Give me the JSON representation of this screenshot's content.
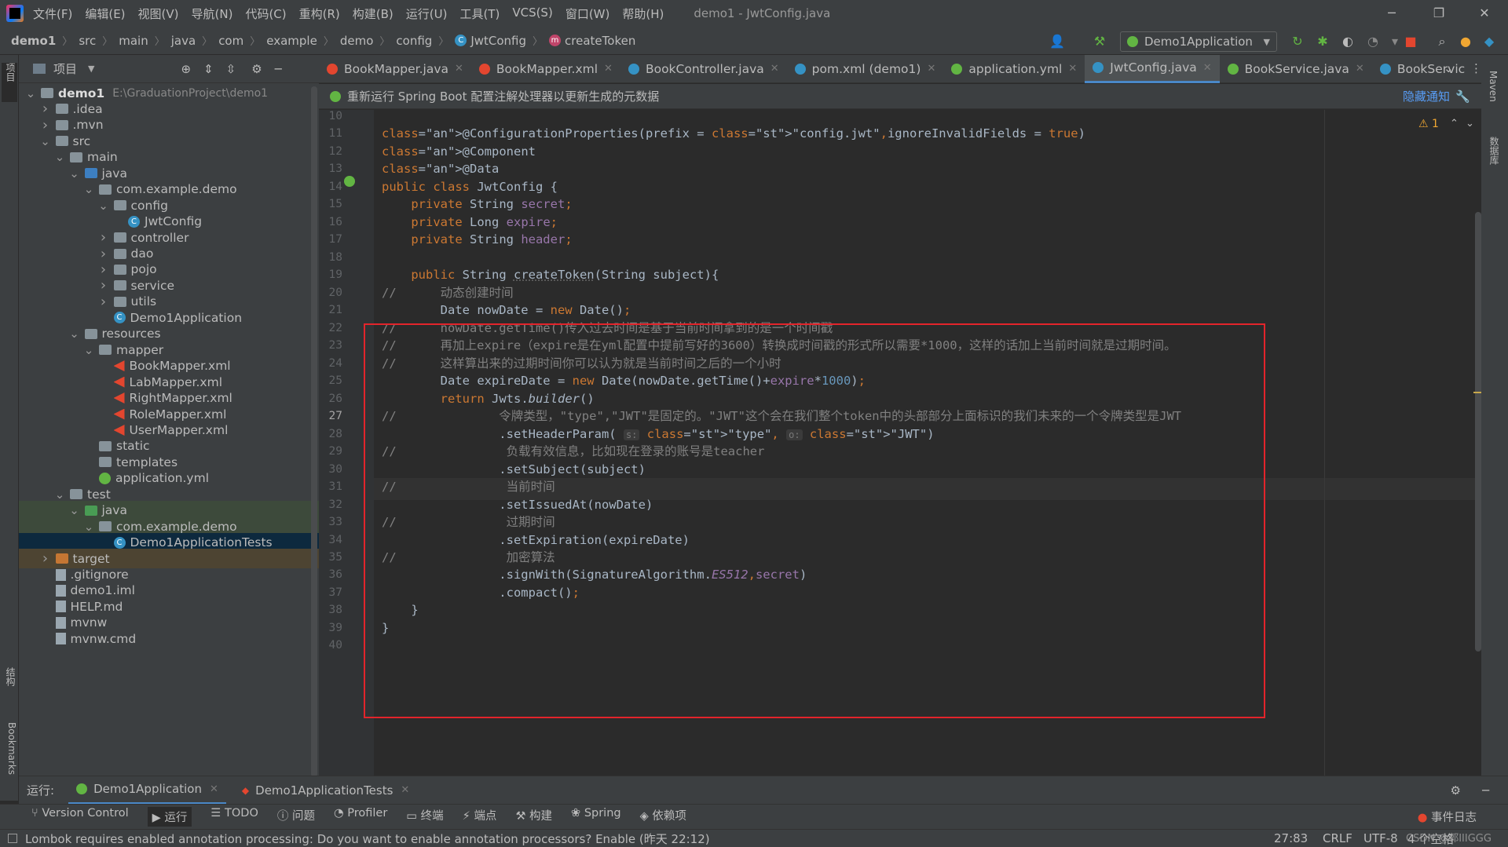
{
  "menu": [
    "文件(F)",
    "编辑(E)",
    "视图(V)",
    "导航(N)",
    "代码(C)",
    "重构(R)",
    "构建(B)",
    "运行(U)",
    "工具(T)",
    "VCS(S)",
    "窗口(W)",
    "帮助(H)"
  ],
  "window_title": "demo1 - JwtConfig.java",
  "breadcrumbs": [
    "demo1",
    "src",
    "main",
    "java",
    "com",
    "example",
    "demo",
    "config",
    "JwtConfig",
    "createToken"
  ],
  "run_config": "Demo1Application",
  "project_panel": {
    "title": "项目"
  },
  "tree": [
    {
      "label": "demo1",
      "extra": "E:\\GraduationProject\\demo1",
      "depth": 0,
      "arrow": "down",
      "icon": "folder"
    },
    {
      "label": ".idea",
      "depth": 1,
      "arrow": "right",
      "icon": "folder"
    },
    {
      "label": ".mvn",
      "depth": 1,
      "arrow": "right",
      "icon": "folder"
    },
    {
      "label": "src",
      "depth": 1,
      "arrow": "down",
      "icon": "folder"
    },
    {
      "label": "main",
      "depth": 2,
      "arrow": "down",
      "icon": "folder"
    },
    {
      "label": "java",
      "depth": 3,
      "arrow": "down",
      "icon": "src"
    },
    {
      "label": "com.example.demo",
      "depth": 4,
      "arrow": "down",
      "icon": "folder"
    },
    {
      "label": "config",
      "depth": 5,
      "arrow": "down",
      "icon": "folder"
    },
    {
      "label": "JwtConfig",
      "depth": 6,
      "arrow": "",
      "icon": "class"
    },
    {
      "label": "controller",
      "depth": 5,
      "arrow": "right",
      "icon": "folder"
    },
    {
      "label": "dao",
      "depth": 5,
      "arrow": "right",
      "icon": "folder"
    },
    {
      "label": "pojo",
      "depth": 5,
      "arrow": "right",
      "icon": "folder"
    },
    {
      "label": "service",
      "depth": 5,
      "arrow": "right",
      "icon": "folder"
    },
    {
      "label": "utils",
      "depth": 5,
      "arrow": "right",
      "icon": "folder"
    },
    {
      "label": "Demo1Application",
      "depth": 5,
      "arrow": "",
      "icon": "class"
    },
    {
      "label": "resources",
      "depth": 3,
      "arrow": "down",
      "icon": "folder"
    },
    {
      "label": "mapper",
      "depth": 4,
      "arrow": "down",
      "icon": "folder"
    },
    {
      "label": "BookMapper.xml",
      "depth": 5,
      "arrow": "",
      "icon": "xml"
    },
    {
      "label": "LabMapper.xml",
      "depth": 5,
      "arrow": "",
      "icon": "xml"
    },
    {
      "label": "RightMapper.xml",
      "depth": 5,
      "arrow": "",
      "icon": "xml"
    },
    {
      "label": "RoleMapper.xml",
      "depth": 5,
      "arrow": "",
      "icon": "xml"
    },
    {
      "label": "UserMapper.xml",
      "depth": 5,
      "arrow": "",
      "icon": "xml"
    },
    {
      "label": "static",
      "depth": 4,
      "arrow": "",
      "icon": "folder"
    },
    {
      "label": "templates",
      "depth": 4,
      "arrow": "",
      "icon": "folder"
    },
    {
      "label": "application.yml",
      "depth": 4,
      "arrow": "",
      "icon": "yml"
    },
    {
      "label": "test",
      "depth": 2,
      "arrow": "down",
      "icon": "folder"
    },
    {
      "label": "java",
      "depth": 3,
      "arrow": "down",
      "icon": "test"
    },
    {
      "label": "com.example.demo",
      "depth": 4,
      "arrow": "down",
      "icon": "folder"
    },
    {
      "label": "Demo1ApplicationTests",
      "depth": 5,
      "arrow": "",
      "icon": "class"
    },
    {
      "label": "target",
      "depth": 1,
      "arrow": "right",
      "icon": "orange"
    },
    {
      "label": ".gitignore",
      "depth": 1,
      "arrow": "",
      "icon": "file"
    },
    {
      "label": "demo1.iml",
      "depth": 1,
      "arrow": "",
      "icon": "file"
    },
    {
      "label": "HELP.md",
      "depth": 1,
      "arrow": "",
      "icon": "file"
    },
    {
      "label": "mvnw",
      "depth": 1,
      "arrow": "",
      "icon": "file"
    },
    {
      "label": "mvnw.cmd",
      "depth": 1,
      "arrow": "",
      "icon": "file"
    }
  ],
  "tabs": [
    {
      "label": "BookMapper.java",
      "color": "#e3462f"
    },
    {
      "label": "BookMapper.xml",
      "color": "#e3462f"
    },
    {
      "label": "BookController.java",
      "color": "#3592c4"
    },
    {
      "label": "pom.xml (demo1)",
      "color": "#3592c4"
    },
    {
      "label": "application.yml",
      "color": "#62b543"
    },
    {
      "label": "JwtConfig.java",
      "color": "#3592c4",
      "active": true
    },
    {
      "label": "BookService.java",
      "color": "#62b543"
    },
    {
      "label": "BookServic",
      "color": "#3592c4"
    }
  ],
  "notice": {
    "text": "重新运行 Spring Boot 配置注解处理器以更新生成的元数据",
    "hide": "隐藏通知"
  },
  "warning_count": "1",
  "code": {
    "first_line": 10,
    "lines": [
      "",
      "@ConfigurationProperties(prefix = \"config.jwt\",ignoreInvalidFields = true)",
      "@Component",
      "@Data",
      "public class JwtConfig {",
      "    private String secret;",
      "    private Long expire;",
      "    private String header;",
      "",
      "    public String createToken(String subject){",
      "//      动态创建时间",
      "        Date nowDate = new Date();",
      "//      nowDate.getTime()传入过去时间是基于当前时间拿到的是一个时间戳",
      "//      再加上expire（expire是在yml配置中提前写好的3600）转换成时间戳的形式所以需要*1000，这样的话加上当前时间就是过期时间。",
      "//      这样算出来的过期时间你可以认为就是当前时间之后的一个小时",
      "        Date expireDate = new Date(nowDate.getTime()+expire*1000);",
      "        return Jwts.builder()",
      "//              令牌类型，\"type\",\"JWT\"是固定的。\"JWT\"这个会在我们整个token中的头部部分上面标识的我们未来的一个令牌类型是JWT",
      "                .setHeaderParam( s: \"type\", o: \"JWT\")",
      "//               负载有效信息，比如现在登录的账号是teacher",
      "                .setSubject(subject)",
      "//               当前时间",
      "                .setIssuedAt(nowDate)",
      "//               过期时间",
      "                .setExpiration(expireDate)",
      "//               加密算法",
      "                .signWith(SignatureAlgorithm.ES512,secret)",
      "                .compact();",
      "    }",
      "}",
      ""
    ]
  },
  "run_bar": {
    "label": "运行:",
    "tabs": [
      "Demo1Application",
      "Demo1ApplicationTests"
    ]
  },
  "bottom_tools": [
    "Version Control",
    "运行",
    "TODO",
    "问题",
    "Profiler",
    "终端",
    "端点",
    "构建",
    "Spring",
    "依赖项"
  ],
  "event_log": "事件日志",
  "status": {
    "message": "Lombok requires enabled annotation processing: Do you want to enable annotation processors? Enable (昨天 22:12)",
    "position": "27:83",
    "line_sep": "CRLF",
    "encoding": "UTF-8",
    "indent": "4 个空格",
    "watermark": "CSDN @郭IIIGGG"
  },
  "left_vertical_tabs": [
    "项目",
    "结构",
    "Bookmarks"
  ],
  "right_vertical_tabs": [
    "Maven",
    "数据库"
  ]
}
